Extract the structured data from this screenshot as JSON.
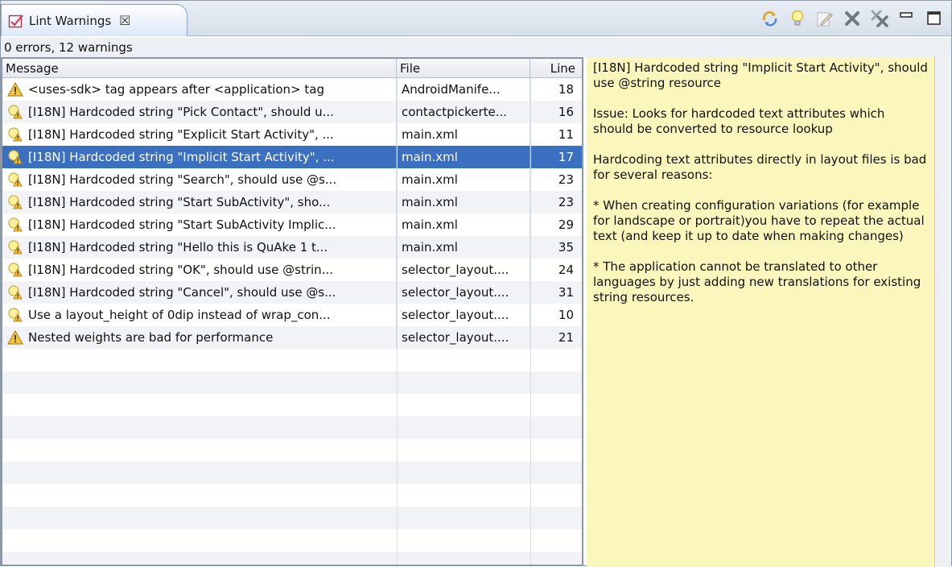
{
  "tab": {
    "title": "Lint Warnings",
    "close_glyph": "☒"
  },
  "toolbar": [
    {
      "name": "refresh-icon"
    },
    {
      "name": "lightbulb-icon"
    },
    {
      "name": "edit-icon"
    },
    {
      "name": "delete-icon"
    },
    {
      "name": "delete-all-icon"
    },
    {
      "name": "minimize-icon"
    },
    {
      "name": "maximize-icon"
    }
  ],
  "summary": "0 errors, 12 warnings",
  "columns": {
    "message": "Message",
    "file": "File",
    "line": "Line"
  },
  "rows": [
    {
      "icon": "warning",
      "message": "<uses-sdk> tag appears after <application> tag",
      "file": "AndroidManife...",
      "line": "18"
    },
    {
      "icon": "fix",
      "message": "[I18N] Hardcoded string \"Pick Contact\", should u...",
      "file": "contactpickerte...",
      "line": "16"
    },
    {
      "icon": "fix",
      "message": "[I18N] Hardcoded string \"Explicit Start Activity\", ...",
      "file": "main.xml",
      "line": "11"
    },
    {
      "icon": "fix",
      "message": "[I18N] Hardcoded string \"Implicit Start Activity\", ...",
      "file": "main.xml",
      "line": "17",
      "selected": true
    },
    {
      "icon": "fix",
      "message": "[I18N] Hardcoded string \"Search\", should use @s...",
      "file": "main.xml",
      "line": "23"
    },
    {
      "icon": "fix",
      "message": "[I18N] Hardcoded string \"Start SubActivity\", sho...",
      "file": "main.xml",
      "line": "23"
    },
    {
      "icon": "fix",
      "message": "[I18N] Hardcoded string \"Start SubActivity Implic...",
      "file": "main.xml",
      "line": "29"
    },
    {
      "icon": "fix",
      "message": "[I18N] Hardcoded string \"Hello this is QuAke 1 t...",
      "file": "main.xml",
      "line": "35"
    },
    {
      "icon": "fix",
      "message": "[I18N] Hardcoded string \"OK\", should use @strin...",
      "file": "selector_layout....",
      "line": "24"
    },
    {
      "icon": "fix",
      "message": "[I18N] Hardcoded string \"Cancel\", should use @s...",
      "file": "selector_layout....",
      "line": "31"
    },
    {
      "icon": "fix",
      "message": "Use a layout_height of 0dip instead of wrap_con...",
      "file": "selector_layout....",
      "line": "10"
    },
    {
      "icon": "warning",
      "message": "Nested weights are bad for performance",
      "file": "selector_layout....",
      "line": "21"
    }
  ],
  "detail": {
    "paragraphs": [
      "[I18N] Hardcoded string \"Implicit Start Activity\", should use @string resource",
      "Issue: Looks for hardcoded text attributes which should be converted to resource lookup",
      "Hardcoding text attributes directly in layout files is bad for several reasons:",
      "* When creating configuration variations (for example for landscape or portrait)you have to repeat the actual text (and keep it up to date when making changes)",
      "* The application cannot be translated to other languages by just adding new translations for existing string resources."
    ]
  }
}
